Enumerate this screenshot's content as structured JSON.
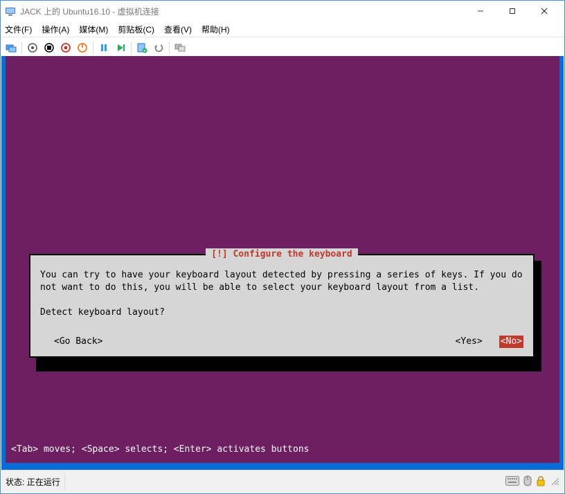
{
  "window": {
    "title": "JACK 上的 Ubuntu16.10 - 虚拟机连接"
  },
  "menu": {
    "file": "文件(F)",
    "action": "操作(A)",
    "media": "媒体(M)",
    "clipboard": "剪贴板(C)",
    "view": "查看(V)",
    "help": "帮助(H)"
  },
  "dialog": {
    "title": "[!] Configure the keyboard",
    "body": "You can try to have your keyboard layout detected by pressing a series of keys. If you do not want to do this, you will be able to select your keyboard layout from a list.\n\nDetect keyboard layout?",
    "go_back": "<Go Back>",
    "yes": "<Yes>",
    "no": "<No>"
  },
  "hint": "<Tab> moves; <Space> selects; <Enter> activates buttons",
  "status": {
    "label": "状态:",
    "value": "正在运行"
  }
}
